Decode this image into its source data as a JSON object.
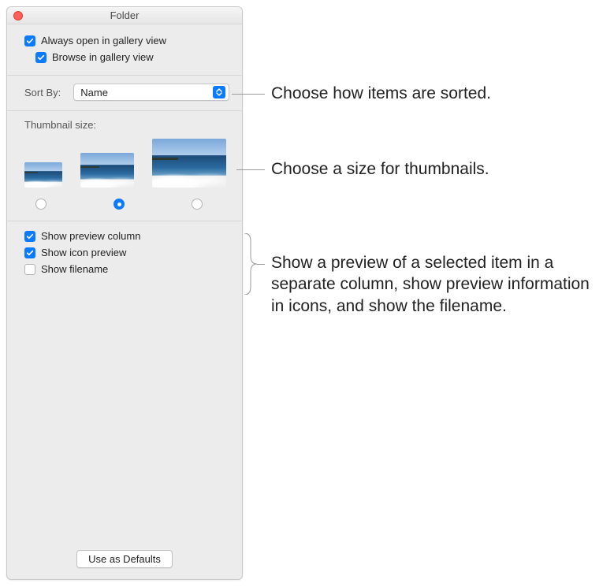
{
  "window": {
    "title": "Folder"
  },
  "view_options": {
    "always_open_gallery": {
      "label": "Always open in gallery view",
      "checked": true
    },
    "browse_gallery": {
      "label": "Browse in gallery view",
      "checked": true
    }
  },
  "sort": {
    "label": "Sort By:",
    "value": "Name"
  },
  "thumbnail": {
    "label": "Thumbnail size:",
    "selected_index": 1
  },
  "preview_options": {
    "show_preview_column": {
      "label": "Show preview column",
      "checked": true
    },
    "show_icon_preview": {
      "label": "Show icon preview",
      "checked": true
    },
    "show_filename": {
      "label": "Show filename",
      "checked": false
    }
  },
  "defaults_button": "Use as Defaults",
  "callouts": {
    "sort": "Choose how items are sorted.",
    "thumbnail": "Choose a size for thumbnails.",
    "preview": "Show a preview of a selected item in a separate column, show preview information in icons, and show the filename."
  }
}
